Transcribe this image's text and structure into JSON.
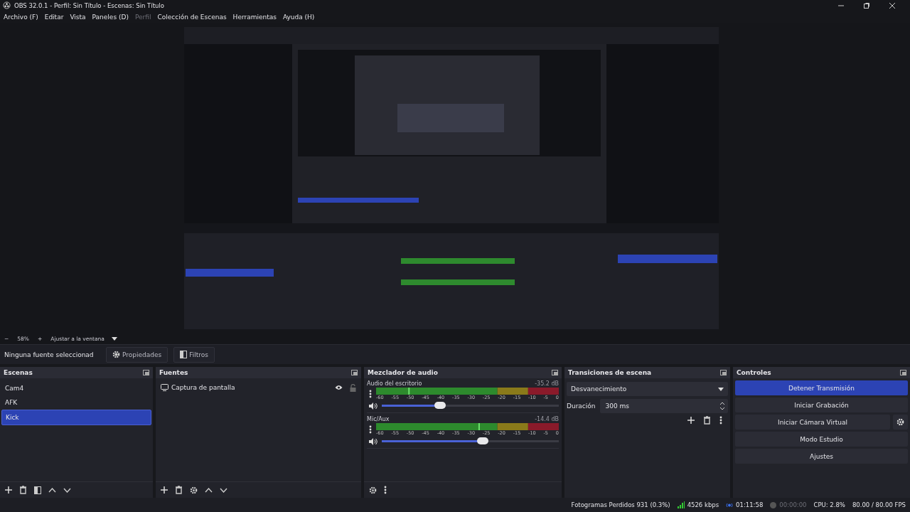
{
  "window": {
    "title": "OBS 32.0.1 - Perfil: Sin Título - Escenas: Sin Título"
  },
  "menu": [
    {
      "label": "Archivo (F)",
      "disabled": false
    },
    {
      "label": "Editar",
      "disabled": false
    },
    {
      "label": "Vista",
      "disabled": false
    },
    {
      "label": "Paneles (D)",
      "disabled": false
    },
    {
      "label": "Perfil",
      "disabled": true
    },
    {
      "label": "Colección de Escenas",
      "disabled": false
    },
    {
      "label": "Herramientas",
      "disabled": false
    },
    {
      "label": "Ayuda (H)",
      "disabled": false
    }
  ],
  "zoom_bar": {
    "minus": "−",
    "zoom": "58%",
    "plus": "+",
    "fit": "Ajustar a la ventana"
  },
  "context_bar": {
    "source": "Ninguna fuente seleccionad",
    "properties": "Propiedades",
    "filters": "Filtros"
  },
  "scenes": {
    "title": "Escenas",
    "items": [
      {
        "label": "Cam4",
        "selected": false
      },
      {
        "label": "AFK",
        "selected": false
      },
      {
        "label": "Kick",
        "selected": true
      }
    ]
  },
  "sources": {
    "title": "Fuentes",
    "items": [
      {
        "label": "Captura de pantalla",
        "visible": true,
        "locked": false
      }
    ]
  },
  "mixer": {
    "title": "Mezclador de audio",
    "channels": [
      {
        "name": "Audio del escritorio",
        "reading": "-35.2 dB",
        "level": 0.33,
        "ticks": [
          "-60",
          "-55",
          "-50",
          "-45",
          "-40",
          "-35",
          "-30",
          "-25",
          "-20",
          "-15",
          "-10",
          "-5",
          "0"
        ]
      },
      {
        "name": "Mic/Aux",
        "reading": "-14.4 dB",
        "level": 0.57,
        "ticks": [
          "-60",
          "-55",
          "-50",
          "-45",
          "-40",
          "-35",
          "-30",
          "-25",
          "-20",
          "-15",
          "-10",
          "-5",
          "0"
        ]
      }
    ]
  },
  "transitions": {
    "title": "Transiciones de escena",
    "type": "Desvanecimiento",
    "duration_label": "Duración",
    "duration": "300 ms"
  },
  "controls": {
    "title": "Controles",
    "buttons": [
      {
        "label": "Detener Transmisión",
        "active": true,
        "settings": false
      },
      {
        "label": "Iniciar Grabación",
        "active": false,
        "settings": false
      },
      {
        "label": "Iniciar Cámara Virtual",
        "active": false,
        "settings": true
      },
      {
        "label": "Modo Estudio",
        "active": false,
        "settings": false
      },
      {
        "label": "Ajustes",
        "active": false,
        "settings": false
      }
    ]
  },
  "status_bar": {
    "dropped": "Fotogramas Perdidos 931 (0.3%)",
    "bitrate": "4526 kbps",
    "stream_time": "01:11:58",
    "record_time": "00:00:00",
    "cpu": "CPU: 2.8%",
    "fps": "80.00 / 80.00 FPS"
  }
}
